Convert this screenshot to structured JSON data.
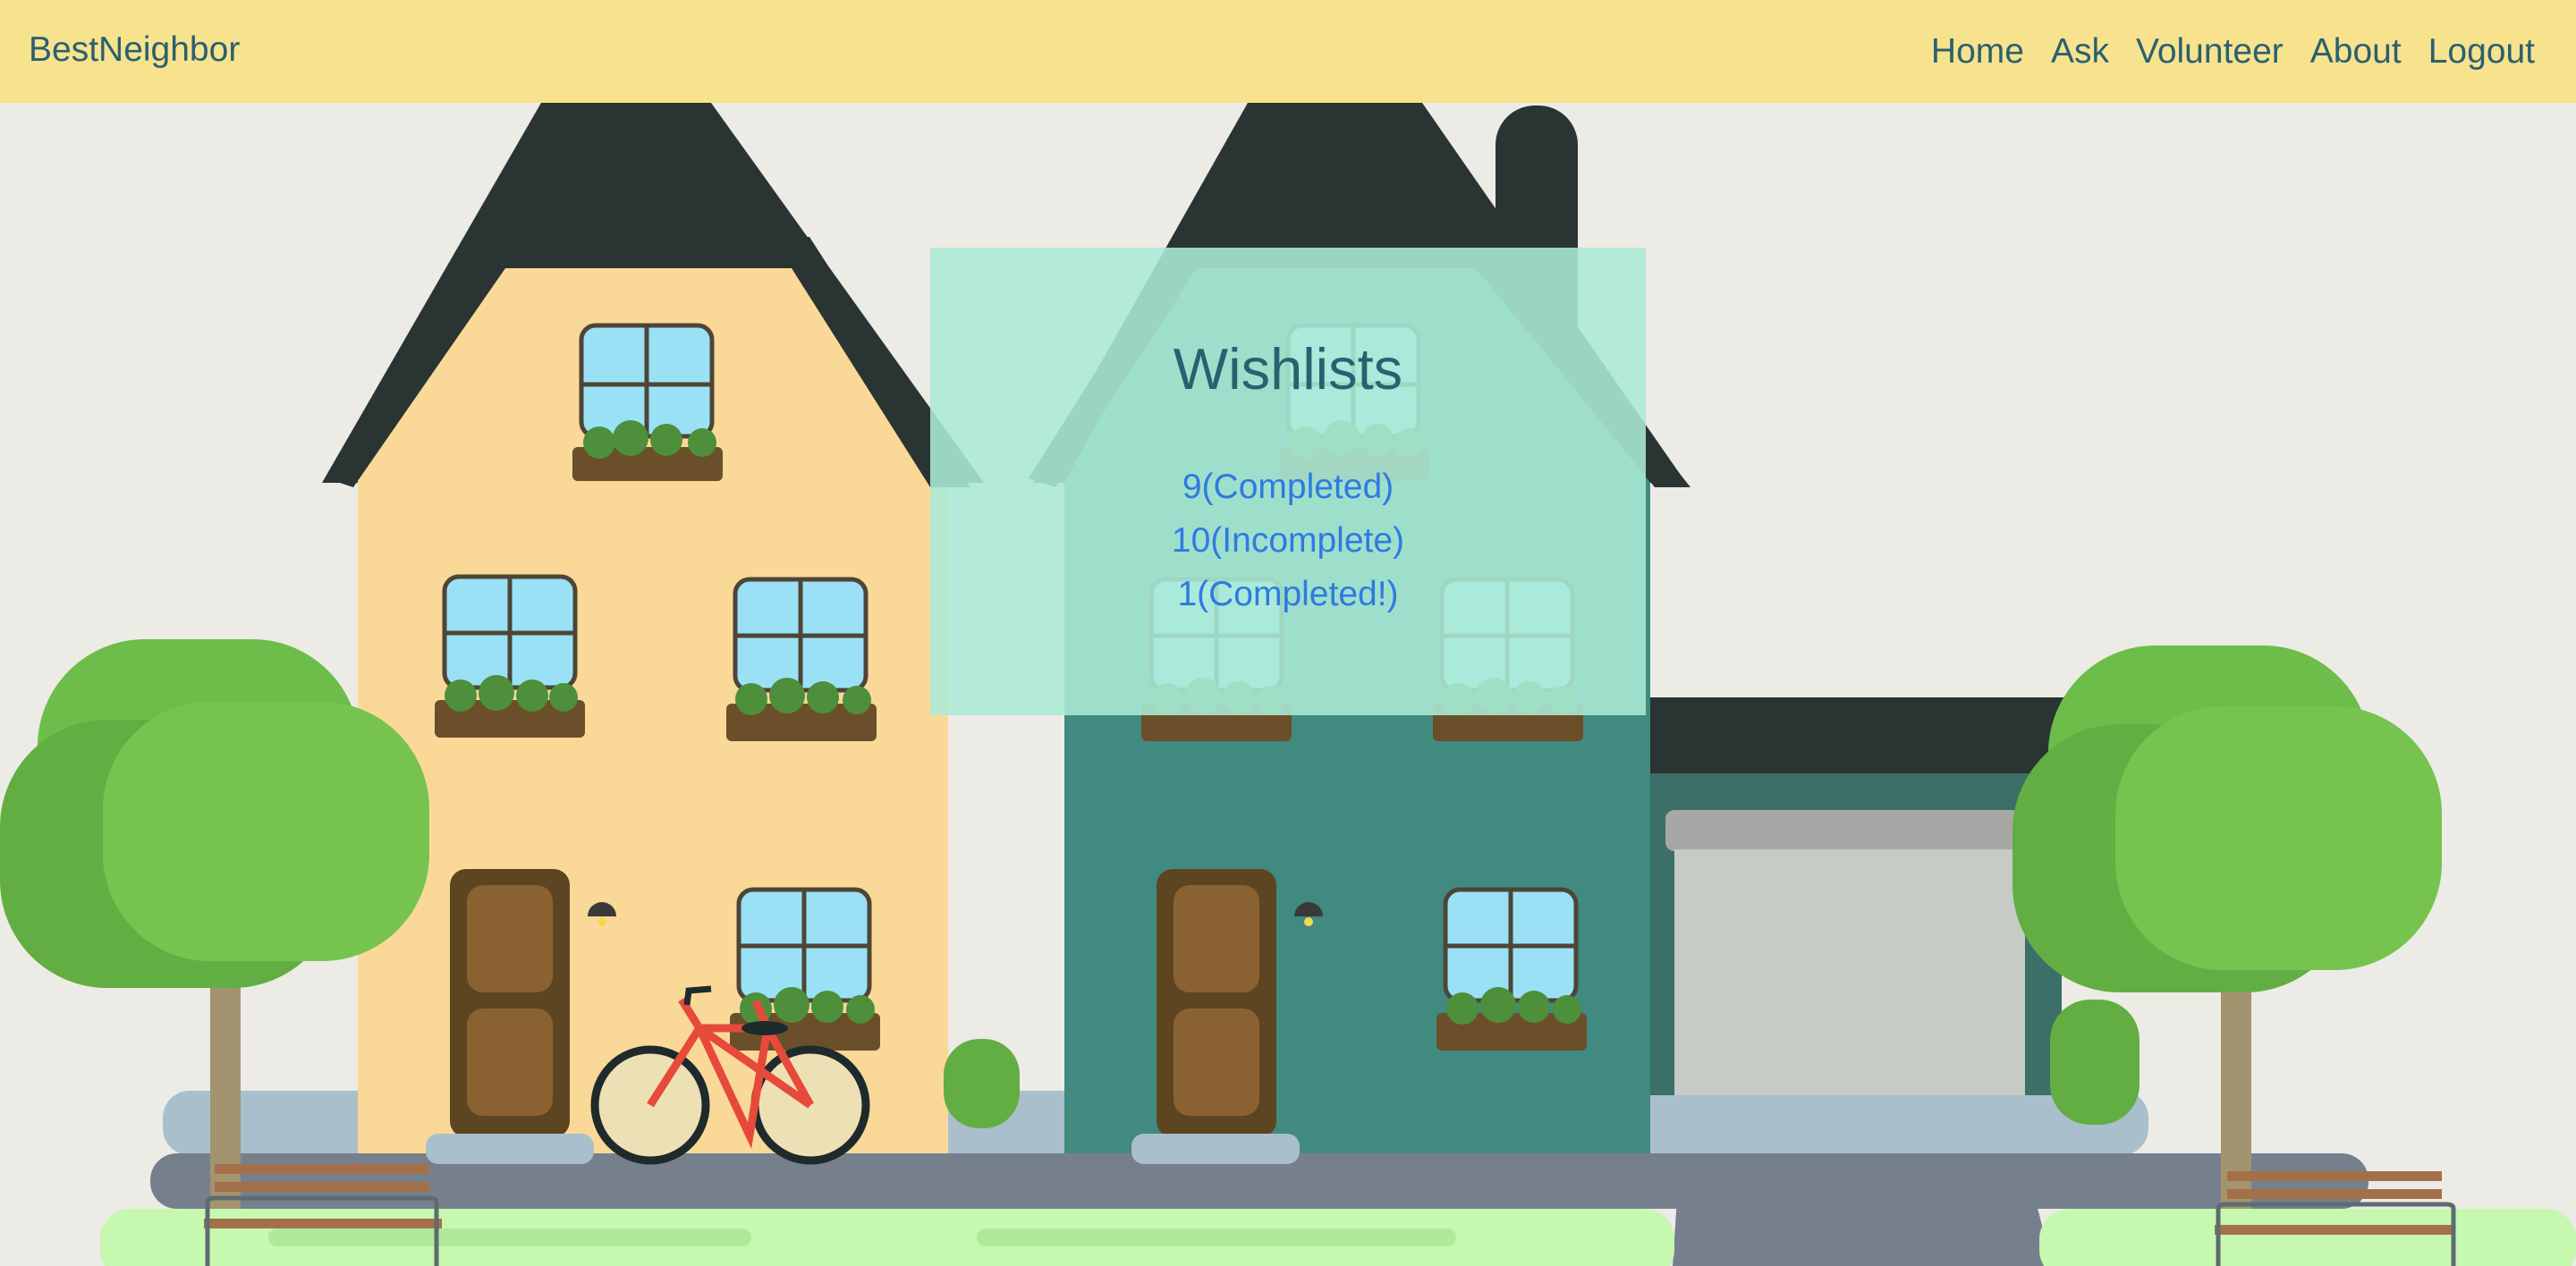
{
  "navbar": {
    "brand": "BestNeighbor",
    "links": [
      "Home",
      "Ask",
      "Volunteer",
      "About",
      "Logout"
    ]
  },
  "panel": {
    "title": "Wishlists",
    "items": [
      "9(Completed)",
      "10(Incomplete)",
      "1(Completed!)"
    ]
  },
  "colors": {
    "navbar_bg": "#f7e28e",
    "nav_text": "#2a6070",
    "panel_bg": "#abead6",
    "link": "#2f7ae0",
    "house_left": "#fad998",
    "house_right": "#418a80",
    "roof": "#2a3433",
    "tree": "#74c04f",
    "grass": "#c6f8b0"
  }
}
